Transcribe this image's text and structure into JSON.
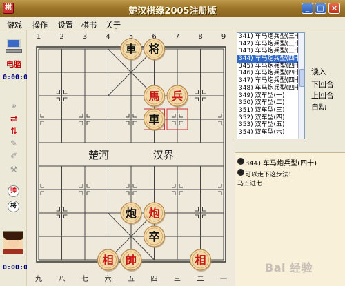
{
  "window": {
    "title": "楚汉棋缘2005注册版",
    "app_icon": "chess-app-icon",
    "app_icon_text": "棋",
    "min_symbol": "_",
    "max_symbol": "□",
    "close_symbol": "×"
  },
  "menu": [
    {
      "label": "游戏"
    },
    {
      "label": "操作"
    },
    {
      "label": "设置"
    },
    {
      "label": "棋书"
    },
    {
      "label": "关于"
    }
  ],
  "left": {
    "player_label": "电脑",
    "timer_top": "0:00:00",
    "timer_bottom": "0:00:00",
    "round_icon_1": "帅",
    "round_icon_2": "将"
  },
  "board": {
    "top_numbers": [
      "1",
      "2",
      "3",
      "4",
      "5",
      "6",
      "7",
      "8",
      "9"
    ],
    "bottom_numbers": [
      "九",
      "八",
      "七",
      "六",
      "五",
      "四",
      "三",
      "二",
      "一"
    ],
    "river_left": "楚河",
    "river_right": "汉界",
    "pieces": [
      {
        "char": "車",
        "side": "black",
        "file": 4,
        "rank": 0
      },
      {
        "char": "将",
        "side": "black",
        "file": 5,
        "rank": 0
      },
      {
        "char": "馬",
        "side": "red",
        "file": 5,
        "rank": 2
      },
      {
        "char": "兵",
        "side": "red",
        "file": 6,
        "rank": 2
      },
      {
        "char": "車",
        "side": "black",
        "file": 5,
        "rank": 3
      },
      {
        "char": "炮",
        "side": "black",
        "file": 4,
        "rank": 7
      },
      {
        "char": "炮",
        "side": "red",
        "file": 5,
        "rank": 7
      },
      {
        "char": "卒",
        "side": "black",
        "file": 5,
        "rank": 8
      },
      {
        "char": "相",
        "side": "red",
        "file": 3,
        "rank": 9
      },
      {
        "char": "帥",
        "side": "red",
        "file": 4,
        "rank": 9
      },
      {
        "char": "相",
        "side": "red",
        "file": 7,
        "rank": 9
      }
    ],
    "highlight_squares": [
      {
        "file": 5,
        "rank": 3
      },
      {
        "file": 6,
        "rank": 3
      }
    ]
  },
  "right": {
    "move_list": [
      "341) 车马炮兵型(三十",
      "342) 车马炮兵型(三十",
      "343) 车马炮兵型(三十",
      "344) 车马炮兵型(四十",
      "345) 车马炮兵型(四十",
      "346) 车马炮兵型(四十",
      "347) 车马炮兵型(四十",
      "348) 车马炮兵型(四十",
      "349) 双车型(一)",
      "350) 双车型(二)",
      "351) 双车型(三)",
      "352) 双车型(四)",
      "353) 双车型(五)",
      "354) 双车型(六)"
    ],
    "selected_index": 3,
    "buttons": [
      "读入",
      "下回合",
      "上回合",
      "自动"
    ],
    "comment_title": "344) 车马炮兵型(四十)",
    "comment_line1": "可以走下这步法：",
    "comment_line2": "马五进七"
  },
  "watermark": "Bai 经验"
}
